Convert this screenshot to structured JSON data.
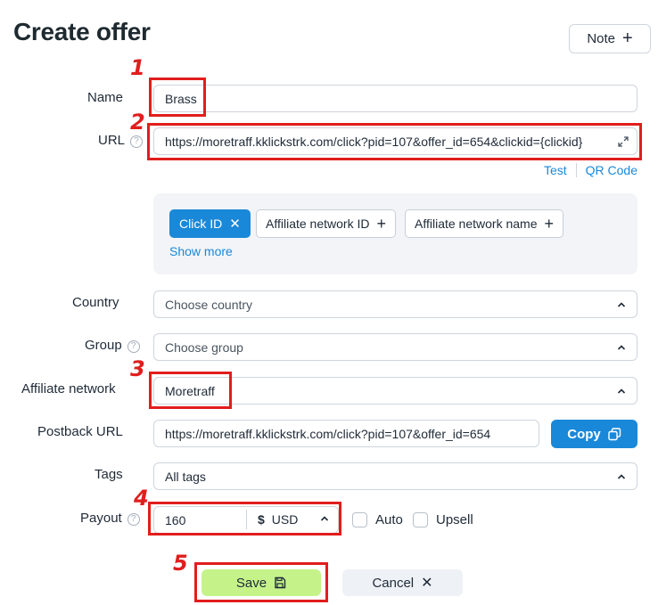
{
  "page": {
    "title": "Create offer",
    "note_label": "Note"
  },
  "form": {
    "name": {
      "label": "Name",
      "value": "Brass"
    },
    "url": {
      "label": "URL",
      "value": "https://moretraff.kklickstrk.com/click?pid=107&offer_id=654&clickid={clickid}"
    },
    "url_links": {
      "test": "Test",
      "qr": "QR Code"
    },
    "tokens": [
      {
        "label": "Click ID",
        "active": true
      },
      {
        "label": "Affiliate network ID",
        "active": false
      },
      {
        "label": "Affiliate network name",
        "active": false
      }
    ],
    "show_more": "Show more",
    "country": {
      "label": "Country",
      "placeholder": "Choose country"
    },
    "group": {
      "label": "Group",
      "placeholder": "Choose group"
    },
    "affiliate_network": {
      "label": "Affiliate network",
      "value": "Moretraff"
    },
    "postback": {
      "label": "Postback URL",
      "value": "https://moretraff.kklickstrk.com/click?pid=107&offer_id=654",
      "copy_label": "Copy"
    },
    "tags": {
      "label": "Tags",
      "placeholder": "All tags"
    },
    "payout": {
      "label": "Payout",
      "value": "160",
      "currency_symbol": "$",
      "currency": "USD",
      "auto_label": "Auto",
      "upsell_label": "Upsell"
    }
  },
  "actions": {
    "save": "Save",
    "cancel": "Cancel"
  },
  "annotations": [
    "1",
    "2",
    "3",
    "4",
    "5"
  ],
  "colors": {
    "accent": "#1a88d8",
    "save_bg": "#c5f38a",
    "annotation": "#e11d1d"
  }
}
